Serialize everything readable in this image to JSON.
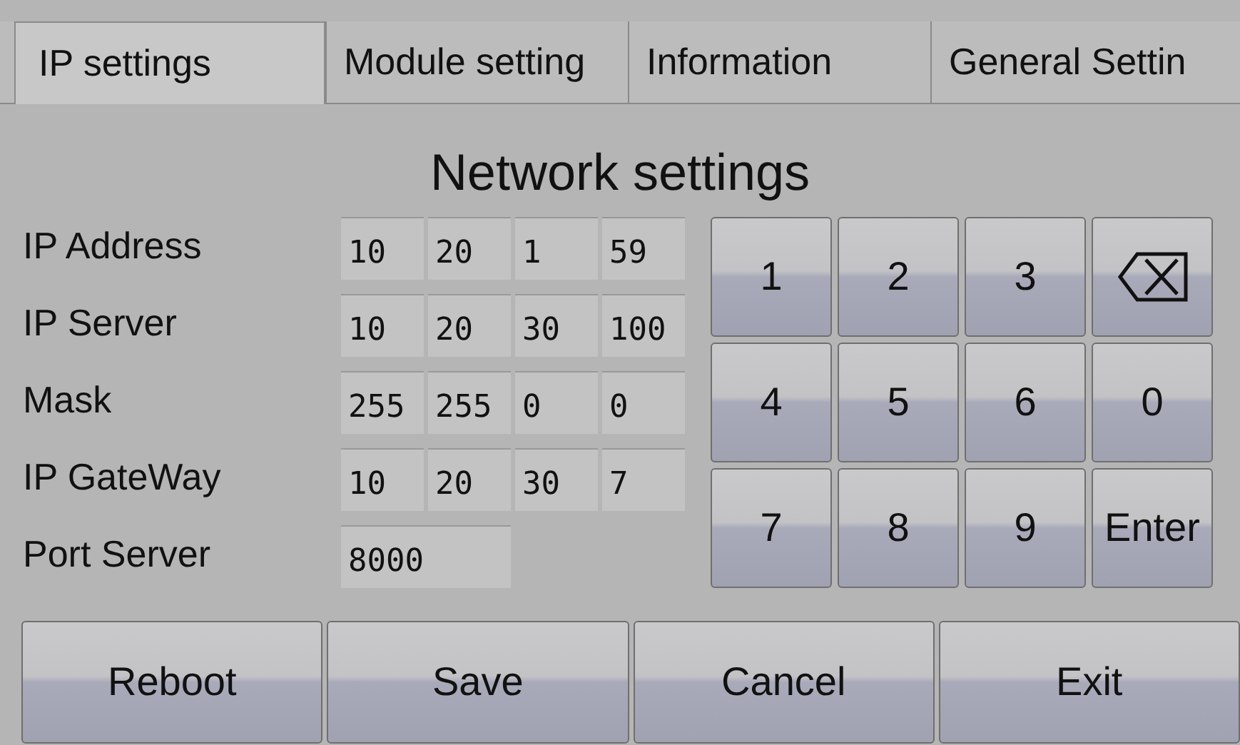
{
  "tabs": [
    {
      "label": "IP settings",
      "selected": true
    },
    {
      "label": "Module setting",
      "selected": false
    },
    {
      "label": "Information",
      "selected": false
    },
    {
      "label": "General Settin",
      "selected": false
    }
  ],
  "title": "Network settings",
  "fields": [
    {
      "label": "IP Address",
      "values": [
        "10",
        "20",
        "1",
        "59"
      ]
    },
    {
      "label": "IP Server",
      "values": [
        "10",
        "20",
        "30",
        "100"
      ]
    },
    {
      "label": "Mask",
      "values": [
        "255",
        "255",
        "0",
        "0"
      ]
    },
    {
      "label": "IP GateWay",
      "values": [
        "10",
        "20",
        "30",
        "7"
      ]
    },
    {
      "label": "Port Server",
      "values": [
        "8000"
      ]
    }
  ],
  "keypad": [
    {
      "kind": "key",
      "label": "1"
    },
    {
      "kind": "key",
      "label": "2"
    },
    {
      "kind": "key",
      "label": "3"
    },
    {
      "kind": "backspace"
    },
    {
      "kind": "key",
      "label": "4"
    },
    {
      "kind": "key",
      "label": "5"
    },
    {
      "kind": "key",
      "label": "6"
    },
    {
      "kind": "key",
      "label": "0"
    },
    {
      "kind": "key",
      "label": "7"
    },
    {
      "kind": "key",
      "label": "8"
    },
    {
      "kind": "key",
      "label": "9"
    },
    {
      "kind": "key",
      "label": "Enter"
    }
  ],
  "buttons": [
    "Reboot",
    "Save",
    "Cancel",
    "Exit"
  ]
}
